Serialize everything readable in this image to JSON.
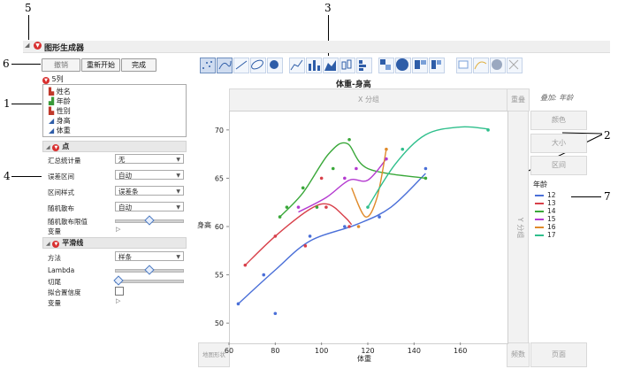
{
  "callouts": {
    "c1": "1",
    "c2": "2",
    "c3": "3",
    "c4": "4",
    "c5": "5",
    "c6": "6",
    "c7": "7"
  },
  "window": {
    "title": "图形生成器"
  },
  "toolbar": {
    "undo": "撤销",
    "restart": "重新开始",
    "done": "完成"
  },
  "columns": {
    "header": "5列",
    "items": [
      {
        "name": "姓名",
        "icon": "nominal-icon"
      },
      {
        "name": "年龄",
        "icon": "ordinal-icon"
      },
      {
        "name": "性别",
        "icon": "nominal-icon"
      },
      {
        "name": "身高",
        "icon": "continuous-icon"
      },
      {
        "name": "体重",
        "icon": "continuous-icon"
      }
    ]
  },
  "points_section": {
    "title": "点",
    "summary_label": "汇总统计量",
    "summary_value": "无",
    "error_label": "误差区间",
    "error_value": "自动",
    "interval_label": "区间样式",
    "interval_value": "误差条",
    "jitter_label": "随机散布",
    "jitter_value": "自动",
    "jitter_limit_label": "随机散布限值",
    "var_label": "变量"
  },
  "smoother_section": {
    "title": "平滑线",
    "method_label": "方法",
    "method_value": "样条",
    "lambda_label": "Lambda",
    "trim_label": "切尾",
    "confidence_label": "拟合置信度",
    "var_label": "变量"
  },
  "zones": {
    "group_x": "X 分组",
    "wrap": "重叠",
    "group_y": "Y 分组",
    "overlay_label": "叠加: 年龄",
    "color": "颜色",
    "size": "大小",
    "interval": "区间",
    "map_shape": "地图形状",
    "freq": "频数",
    "page": "页面"
  },
  "legend": {
    "title": "年龄",
    "items": [
      {
        "label": "12",
        "color": "#4a6fd8"
      },
      {
        "label": "13",
        "color": "#d8404a"
      },
      {
        "label": "14",
        "color": "#3aa83a"
      },
      {
        "label": "15",
        "color": "#b43ad0"
      },
      {
        "label": "16",
        "color": "#e08a2a"
      },
      {
        "label": "17",
        "color": "#2fbf8c"
      }
    ]
  },
  "chart_data": {
    "type": "scatter",
    "title": "体重-身高",
    "xlabel": "体重",
    "ylabel": "身高",
    "xlim": [
      60,
      180
    ],
    "ylim": [
      48,
      72
    ],
    "xticks": [
      60,
      80,
      100,
      120,
      140,
      160
    ],
    "yticks": [
      50,
      55,
      60,
      65,
      70
    ],
    "points": [
      {
        "x": 64,
        "y": 52,
        "g": "12"
      },
      {
        "x": 75,
        "y": 55,
        "g": "12"
      },
      {
        "x": 80,
        "y": 51,
        "g": "12"
      },
      {
        "x": 95,
        "y": 59,
        "g": "12"
      },
      {
        "x": 110,
        "y": 60,
        "g": "12"
      },
      {
        "x": 125,
        "y": 61,
        "g": "12"
      },
      {
        "x": 145,
        "y": 66,
        "g": "12"
      },
      {
        "x": 67,
        "y": 56,
        "g": "13"
      },
      {
        "x": 80,
        "y": 59,
        "g": "13"
      },
      {
        "x": 93,
        "y": 58,
        "g": "13"
      },
      {
        "x": 100,
        "y": 65,
        "g": "13"
      },
      {
        "x": 102,
        "y": 62,
        "g": "13"
      },
      {
        "x": 112,
        "y": 60,
        "g": "13"
      },
      {
        "x": 82,
        "y": 61,
        "g": "14"
      },
      {
        "x": 85,
        "y": 62,
        "g": "14"
      },
      {
        "x": 92,
        "y": 64,
        "g": "14"
      },
      {
        "x": 98,
        "y": 62,
        "g": "14"
      },
      {
        "x": 105,
        "y": 66,
        "g": "14"
      },
      {
        "x": 112,
        "y": 69,
        "g": "14"
      },
      {
        "x": 145,
        "y": 65,
        "g": "14"
      },
      {
        "x": 90,
        "y": 62,
        "g": "15"
      },
      {
        "x": 110,
        "y": 65,
        "g": "15"
      },
      {
        "x": 115,
        "y": 66,
        "g": "15"
      },
      {
        "x": 128,
        "y": 67,
        "g": "15"
      },
      {
        "x": 116,
        "y": 60,
        "g": "16"
      },
      {
        "x": 128,
        "y": 68,
        "g": "16"
      },
      {
        "x": 120,
        "y": 62,
        "g": "17"
      },
      {
        "x": 135,
        "y": 68,
        "g": "17"
      },
      {
        "x": 172,
        "y": 70,
        "g": "17"
      }
    ],
    "smoothers": [
      {
        "g": "12",
        "pts": [
          [
            64,
            52
          ],
          [
            80,
            55.5
          ],
          [
            95,
            58.5
          ],
          [
            115,
            60.2
          ],
          [
            130,
            62
          ],
          [
            145,
            65.5
          ]
        ]
      },
      {
        "g": "13",
        "pts": [
          [
            67,
            56
          ],
          [
            80,
            59
          ],
          [
            95,
            61.8
          ],
          [
            103,
            62.3
          ],
          [
            110,
            61
          ],
          [
            113,
            60.2
          ]
        ]
      },
      {
        "g": "14",
        "pts": [
          [
            82,
            61
          ],
          [
            92,
            63.5
          ],
          [
            103,
            67.5
          ],
          [
            111,
            68.6
          ],
          [
            120,
            66
          ],
          [
            145,
            65
          ]
        ]
      },
      {
        "g": "15",
        "pts": [
          [
            90,
            61.5
          ],
          [
            102,
            63
          ],
          [
            112,
            64.8
          ],
          [
            120,
            64.8
          ],
          [
            128,
            67
          ]
        ]
      },
      {
        "g": "16",
        "pts": [
          [
            113,
            64
          ],
          [
            119,
            61
          ],
          [
            124,
            63
          ],
          [
            128,
            68
          ]
        ]
      },
      {
        "g": "17",
        "pts": [
          [
            120,
            62
          ],
          [
            132,
            66.5
          ],
          [
            145,
            69.5
          ],
          [
            160,
            70.3
          ],
          [
            172,
            70.1
          ]
        ]
      }
    ]
  }
}
